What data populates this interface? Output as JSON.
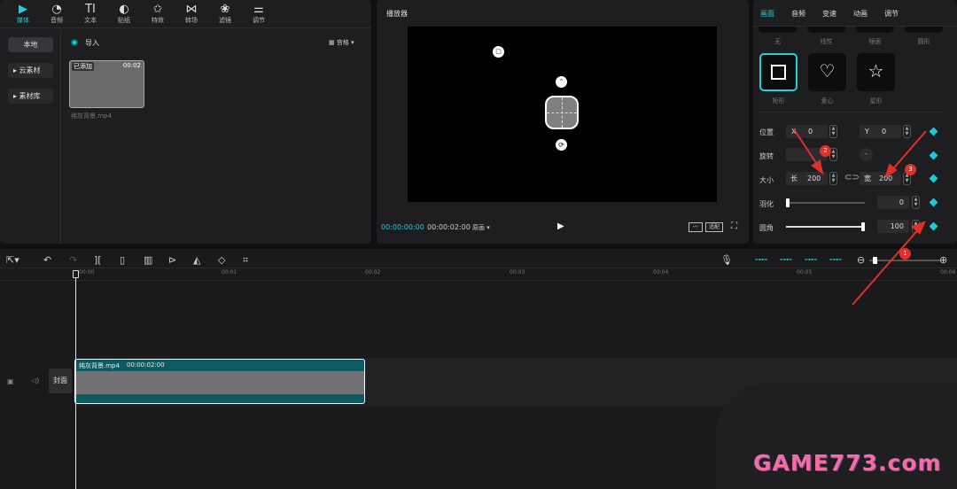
{
  "toolbar": {
    "items": [
      {
        "label": "媒体",
        "icon": "▶"
      },
      {
        "label": "音频",
        "icon": "◔"
      },
      {
        "label": "文本",
        "icon": "TI"
      },
      {
        "label": "贴纸",
        "icon": "◐"
      },
      {
        "label": "特效",
        "icon": "✩"
      },
      {
        "label": "转场",
        "icon": "⋈"
      },
      {
        "label": "滤镜",
        "icon": "❀"
      },
      {
        "label": "调节",
        "icon": "⚌"
      }
    ]
  },
  "media": {
    "side": [
      "本地",
      "▸ 云素材",
      "▸ 素材库"
    ],
    "import_label": "导入",
    "view_label": "宫格",
    "clip_added": "已添加",
    "clip_duration": "00:02",
    "clip_name": "纯灰背景.mp4"
  },
  "player": {
    "title": "播放器",
    "current_time": "00:00:00:00",
    "total_time": "00:00:02:00",
    "quality": "原画",
    "ratio": "适配"
  },
  "inspector": {
    "tabs": [
      "画面",
      "音频",
      "变速",
      "动画",
      "调节"
    ],
    "top_labels": [
      "无",
      "线性",
      "镜面",
      "圆形"
    ],
    "shapes": [
      "矩形",
      "爱心",
      "星形"
    ],
    "position_label": "位置",
    "x_label": "X",
    "x_value": "0",
    "y_label": "Y",
    "y_value": "0",
    "rotate_label": "旋转",
    "size_label": "大小",
    "length_label": "长",
    "length_value": "200",
    "width_label": "宽",
    "width_value": "200",
    "feather_label": "羽化",
    "feather_value": "0",
    "corner_label": "圆角",
    "corner_value": "100",
    "feather_level": 0,
    "corner_level": 1
  },
  "timeline": {
    "ruler": [
      "00:00",
      "00:01",
      "00:02",
      "00:03",
      "00:04",
      "00:05",
      "00:06"
    ],
    "cover_label": "封面",
    "clip_name": "纯灰背景.mp4",
    "clip_duration": "00:00:02:00"
  },
  "annotations": [
    "1",
    "2",
    "3"
  ],
  "watermark": "GAME773.com",
  "colors": {
    "accent": "#1fd1e0",
    "annotation": "#e0302a",
    "clip_bg": "#0f5a60"
  }
}
